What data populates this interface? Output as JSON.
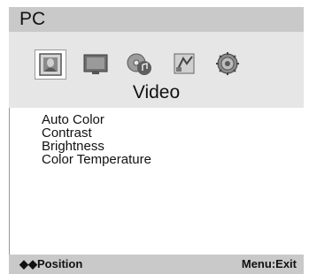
{
  "osd": {
    "title": "PC",
    "section_title": "Video",
    "tabs": [
      {
        "icon": "picture-icon",
        "selected": true
      },
      {
        "icon": "monitor-icon",
        "selected": false
      },
      {
        "icon": "audio-cd-icon",
        "selected": false
      },
      {
        "icon": "setup-icon",
        "selected": false
      },
      {
        "icon": "settings-gear-icon",
        "selected": false
      }
    ],
    "menu_items": [
      "Auto Color",
      "Contrast",
      "Brightness",
      "Color Temperature"
    ],
    "footer": {
      "navigation_arrows": "◆◆",
      "navigation_label": "Position",
      "exit_label": "Menu:Exit"
    },
    "colors": {
      "header_bar": "#c9c9c9",
      "icon_bar": "#e6e6e6",
      "text": "#111111"
    }
  }
}
